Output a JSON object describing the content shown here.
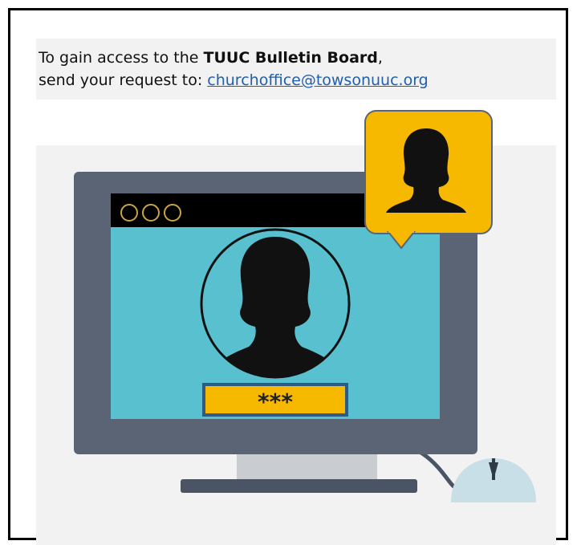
{
  "notice": {
    "prefix": "To gain access to the ",
    "bold": "TUUC Bulletin Board",
    "comma": ",",
    "line2": "send your request to: ",
    "email": "churchoffice@towsonuuc.org"
  },
  "illustration": {
    "password_mask": "***",
    "colors": {
      "monitor_frame": "#5a6474",
      "screen": "#58c0cf",
      "titlebar": "#000000",
      "accent_yellow": "#f7b800",
      "silhouette": "#111111",
      "mouse": "#c8dfe7"
    }
  }
}
